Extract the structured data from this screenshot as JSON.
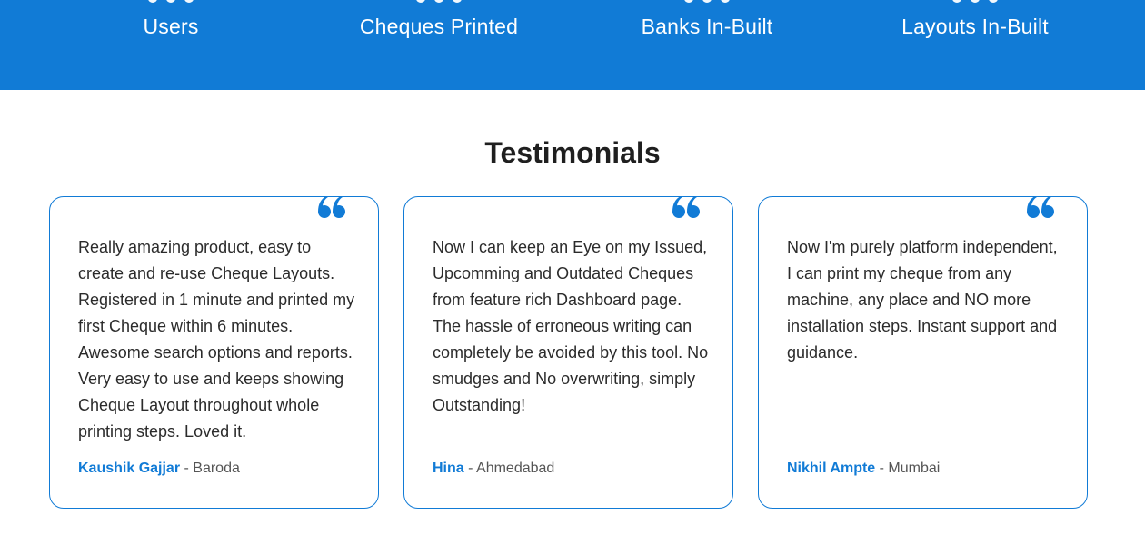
{
  "stats": [
    {
      "label": "Users"
    },
    {
      "label": "Cheques Printed"
    },
    {
      "label": "Banks In-Built"
    },
    {
      "label": "Layouts In-Built"
    }
  ],
  "testimonials": {
    "title": "Testimonials",
    "separator": " - ",
    "items": [
      {
        "text": "Really amazing product, easy to create and re-use Cheque Layouts. Registered in 1 minute and printed my first Cheque within 6 minutes. Awesome search options and reports. Very easy to use and keeps showing Cheque Layout throughout whole printing steps. Loved it.",
        "author": "Kaushik Gajjar",
        "location": "Baroda"
      },
      {
        "text": "Now I can keep an Eye on my Issued, Upcomming and Outdated Cheques from feature rich Dashboard page. The hassle of erroneous writing can completely be avoided by this tool. No smudges and No overwriting, simply Outstanding!",
        "author": "Hina",
        "location": "Ahmedabad"
      },
      {
        "text": "Now I'm purely platform independent, I can print my cheque from any machine, any place and NO more installation steps. Instant support and guidance.",
        "author": "Nikhil Ampte",
        "location": "Mumbai"
      }
    ]
  },
  "colors": {
    "brand_blue": "#117bd6",
    "title_text": "#1f1f1f",
    "body_text": "#2b2b2b"
  },
  "icons": {
    "quote": "quote-icon"
  }
}
